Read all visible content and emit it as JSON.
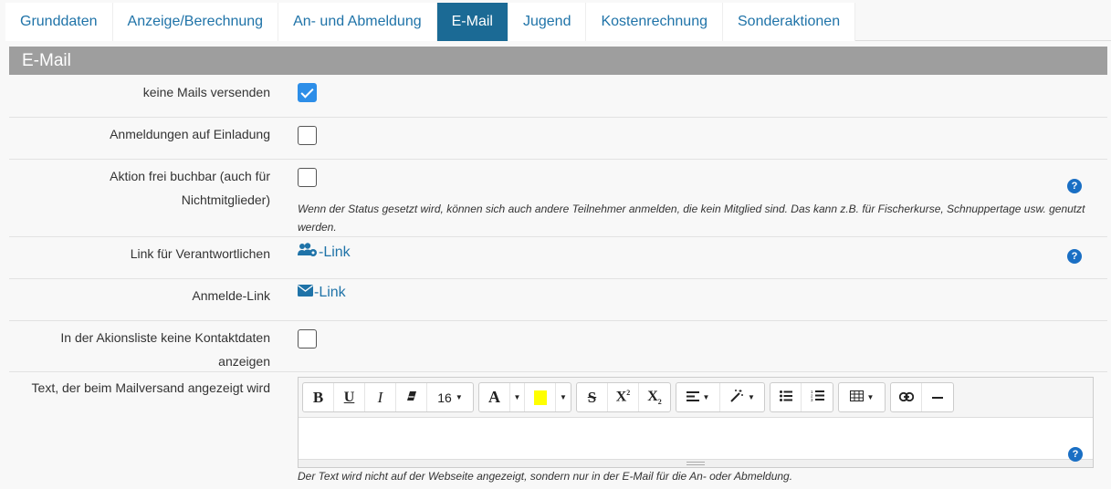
{
  "tabs": [
    {
      "label": "Grunddaten"
    },
    {
      "label": "Anzeige/Berechnung"
    },
    {
      "label": "An- und Abmeldung"
    },
    {
      "label": "E-Mail"
    },
    {
      "label": "Jugend"
    },
    {
      "label": "Kostenrechnung"
    },
    {
      "label": "Sonderaktionen"
    }
  ],
  "active_tab": "E-Mail",
  "section": {
    "title": "E-Mail"
  },
  "rows": {
    "no_mails": {
      "label": "keine Mails versenden",
      "checked": true
    },
    "invite": {
      "label": "Anmeldungen auf Einladung",
      "checked": false
    },
    "free": {
      "label_line1": "Aktion frei buchbar (auch für",
      "label_line2": "Nichtmitglieder)",
      "checked": false,
      "hint": "Wenn der Status gesetzt wird, können sich auch andere Teilnehmer anmelden, die kein Mitglied sind. Das kann z.B. für Fischerkurse, Schnuppertage usw. genutzt werden."
    },
    "responsible": {
      "label": "Link für Verantwortlichen",
      "link_text": "-Link",
      "icon": "users-cog-icon"
    },
    "signup": {
      "label": "Anmelde-Link",
      "link_text": "-Link",
      "icon": "envelope-icon"
    },
    "no_contact": {
      "label_line1": "In der Akionsliste keine Kontaktdaten",
      "label_line2": "anzeigen",
      "checked": false
    },
    "mail_text": {
      "label": "Text, der beim Mailversand angezeigt wird",
      "hint": "Der Text wird nicht auf der Webseite angezeigt, sondern nur in der E-Mail für die An- oder Abmeldung."
    }
  },
  "editor": {
    "font_size": "16",
    "highlight_color": "#ffff00",
    "help_label": "?"
  },
  "colors": {
    "accent": "#1b6a95",
    "link": "#1f73a8",
    "checkbox": "#2d8ee8"
  }
}
